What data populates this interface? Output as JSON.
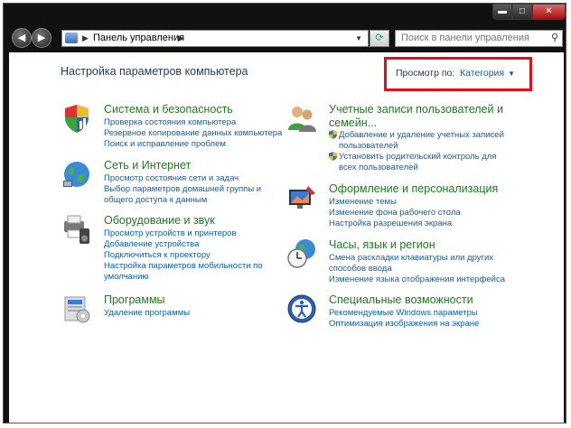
{
  "window": {
    "minimize_glyph": "▬",
    "maximize_glyph": "□",
    "close_glyph": "✕"
  },
  "address": {
    "path": "Панель управления",
    "search_placeholder": "Поиск в панели управления"
  },
  "header": {
    "title": "Настройка параметров компьютера",
    "view_label": "Просмотр по:",
    "view_value": "Категория"
  },
  "categories_left": [
    {
      "title": "Система и безопасность",
      "icon": "shield-chart-icon",
      "links": [
        "Проверка состояния компьютера",
        "Резервное копирование данных компьютера",
        "Поиск и исправление проблем"
      ]
    },
    {
      "title": "Сеть и Интернет",
      "icon": "globe-network-icon",
      "links": [
        "Просмотр состояния сети и задач",
        "Выбор параметров домашней группы и",
        "общего доступа к данным"
      ]
    },
    {
      "title": "Оборудование и звук",
      "icon": "printer-speaker-icon",
      "links": [
        "Просмотр устройств и принтеров",
        "Добавление устройства",
        "Подключиться к проектору",
        "Настройка параметров мобильности по",
        "умолчанию"
      ]
    },
    {
      "title": "Программы",
      "icon": "programs-icon",
      "links": [
        "Удаление программы"
      ]
    }
  ],
  "categories_right": [
    {
      "title_line1": "Учетные записи пользователей и",
      "title_line2": "семейн...",
      "icon": "users-icon",
      "links": [
        "Добавление и удаление учетных записей",
        "пользователей",
        "Установить родительский контроль для",
        "всех пользователей"
      ]
    },
    {
      "title": "Оформление и персонализация",
      "icon": "personalization-icon",
      "links": [
        "Изменение темы",
        "Изменение фона рабочего стола",
        "Настройка разрешения экрана"
      ]
    },
    {
      "title": "Часы, язык и регион",
      "icon": "clock-globe-icon",
      "links": [
        "Смена раскладки клавиатуры или других",
        "способов ввода",
        "Изменение языка отображения интерфейса"
      ]
    },
    {
      "title": "Специальные возможности",
      "icon": "accessibility-icon",
      "links": [
        "Рекомендуемые Windows параметры",
        "Оптимизация изображения на экране"
      ]
    }
  ],
  "colors": {
    "category_title": "#1f7b1f",
    "link": "#0b5fb3",
    "highlight_box": "#e0101a"
  }
}
